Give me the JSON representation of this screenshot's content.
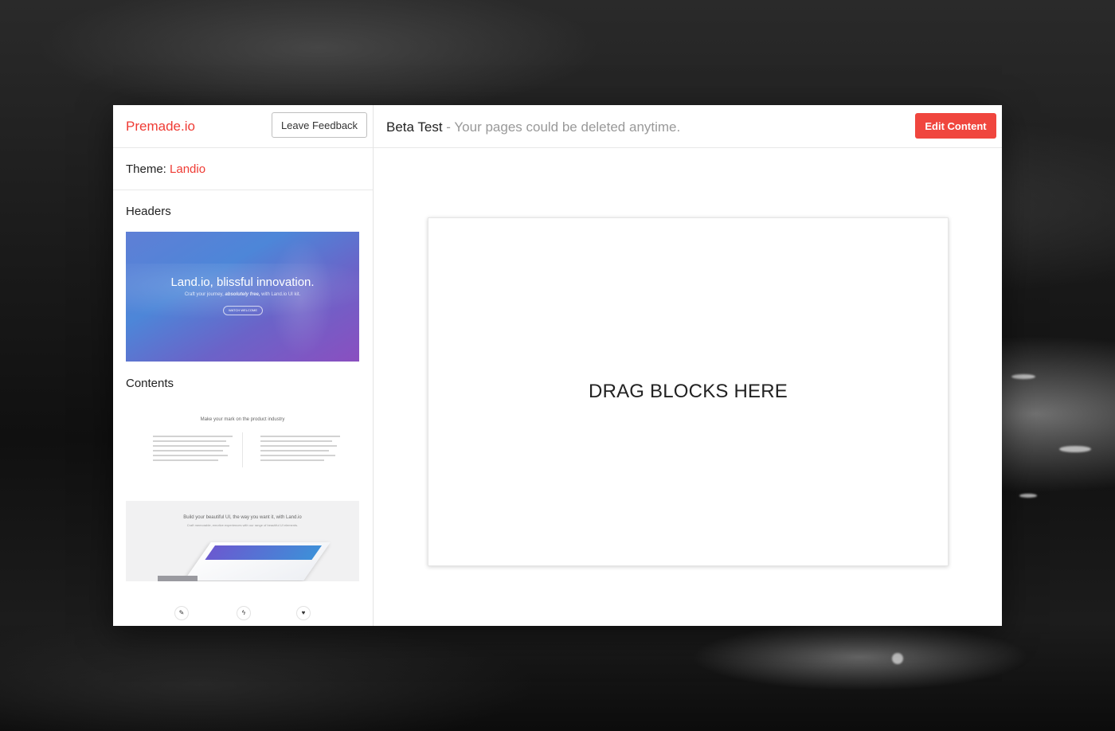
{
  "sidebar": {
    "brand": "Premade.io",
    "feedback_label": "Leave Feedback",
    "theme_label": "Theme:",
    "theme_value": "Landio",
    "sections": {
      "headers_title": "Headers",
      "contents_title": "Contents"
    },
    "header_thumb": {
      "title": "Land.io, blissful innovation.",
      "subtitle_start": "Craft your journey,",
      "subtitle_em": "absolutely free,",
      "subtitle_end": "with Land.io UI kit.",
      "button": "WATCH WELCOME"
    },
    "content_thumb_1": {
      "title": "Make your mark on the product industry"
    },
    "content_thumb_2": {
      "title": "Build your beautiful UI, the way you want it, with Land.io",
      "subtitle": "Craft memorable, emotive experiences with our range of beautiful UI elements."
    },
    "icons": [
      "pencil-icon",
      "bolt-icon",
      "heart-icon"
    ]
  },
  "main": {
    "beta_label": "Beta Test",
    "beta_note": " - Your pages could be deleted anytime.",
    "edit_label": "Edit Content",
    "drop_text": "DRAG BLOCKS HERE"
  },
  "colors": {
    "accent": "#ef3b34",
    "button": "#f0463e"
  }
}
